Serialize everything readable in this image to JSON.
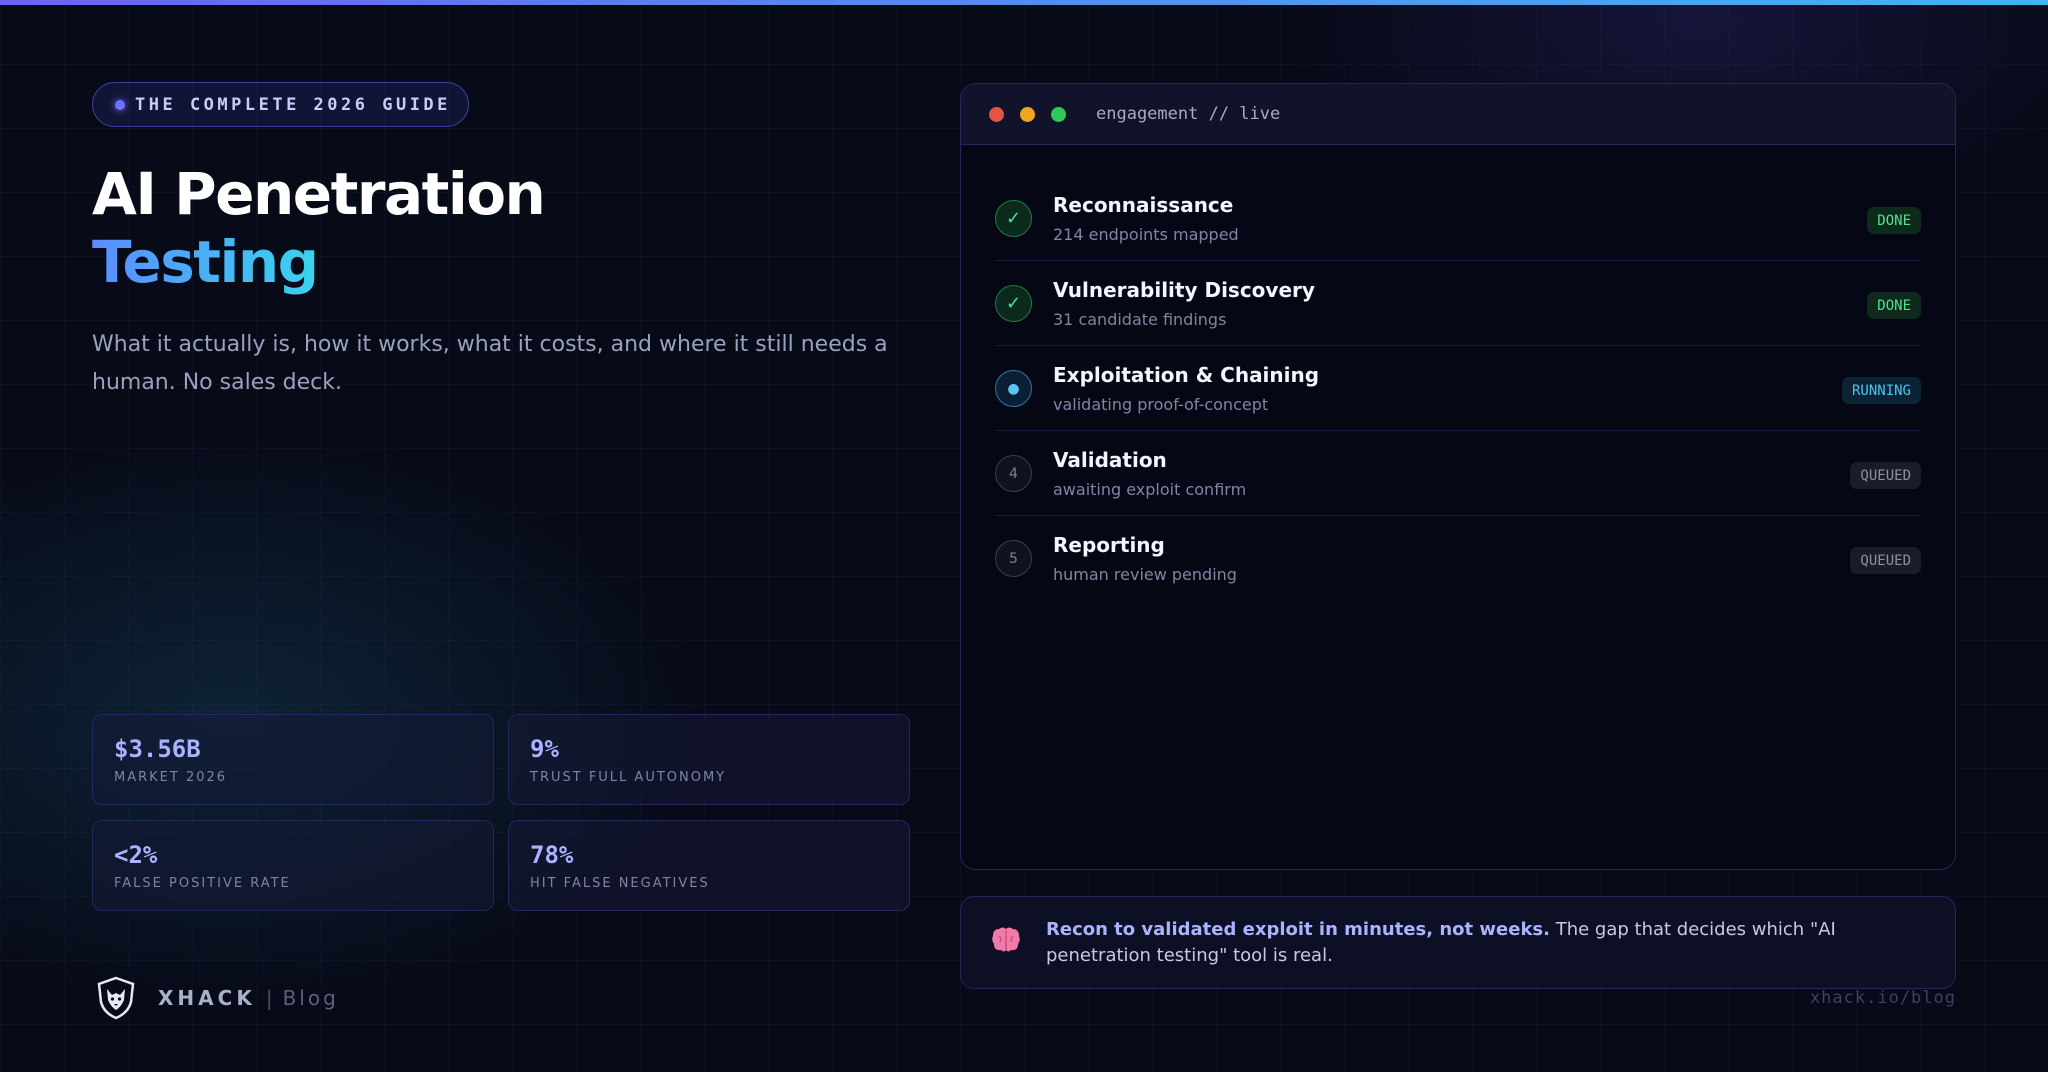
{
  "badge": {
    "label": "THE COMPLETE 2026 GUIDE"
  },
  "hero": {
    "title_line1": "AI Penetration",
    "title_line2": "Testing",
    "subtitle": "What it actually is, how it works, what it costs, and where it still needs a human. No sales deck."
  },
  "stats": [
    {
      "value": "$3.56B",
      "label": "MARKET 2026"
    },
    {
      "value": "9%",
      "label": "TRUST FULL AUTONOMY"
    },
    {
      "value": "<2%",
      "label": "FALSE POSITIVE RATE"
    },
    {
      "value": "78%",
      "label": "HIT FALSE NEGATIVES"
    }
  ],
  "brand": {
    "name": "XHACK",
    "separator": "|",
    "section": "Blog",
    "logo_icon": "wolf-shield-icon"
  },
  "terminal": {
    "title": "engagement // live",
    "steps": [
      {
        "icon": "✓",
        "icon_name": "check-icon",
        "name": "Reconnaissance",
        "detail": "214 endpoints mapped",
        "status": "DONE"
      },
      {
        "icon": "✓",
        "icon_name": "check-icon",
        "name": "Vulnerability Discovery",
        "detail": "31 candidate findings",
        "status": "DONE"
      },
      {
        "icon": "●",
        "icon_name": "running-dot-icon",
        "name": "Exploitation & Chaining",
        "detail": "validating proof-of-concept",
        "status": "RUNNING"
      },
      {
        "icon": "4",
        "icon_name": "step-number",
        "name": "Validation",
        "detail": "awaiting exploit confirm",
        "status": "QUEUED"
      },
      {
        "icon": "5",
        "icon_name": "step-number",
        "name": "Reporting",
        "detail": "human review pending",
        "status": "QUEUED"
      }
    ]
  },
  "note": {
    "icon_name": "brain-icon",
    "strong": "Recon to validated exploit in minutes, not weeks.",
    "text": " The gap that decides which \"AI penetration testing\" tool is real."
  },
  "footer": {
    "url": "xhack.io/blog"
  },
  "colors": {
    "background": "#070a17",
    "accent_blue": "#5b8cff",
    "accent_cyan": "#39d4ee",
    "done": "#52e08c",
    "running": "#4fc2f0",
    "queued": "#8a8fa6"
  }
}
